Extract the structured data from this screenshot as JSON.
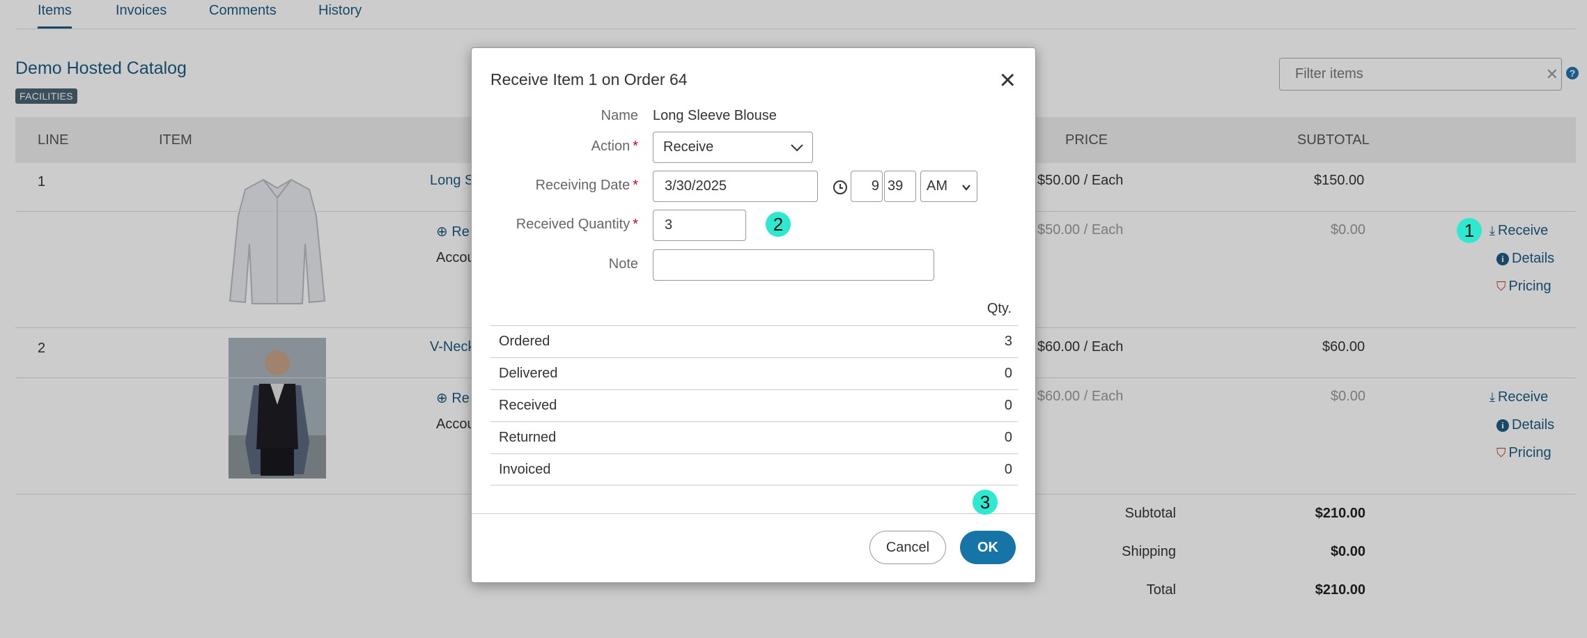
{
  "tabs": [
    "Items",
    "Invoices",
    "Comments",
    "History"
  ],
  "catalog": {
    "title": "Demo Hosted Catalog",
    "badge": "FACILITIES"
  },
  "filter": {
    "placeholder": "Filter items",
    "clear": "✕",
    "help": "?"
  },
  "table": {
    "headers": {
      "line": "LINE",
      "item": "ITEM",
      "price": "PRICE",
      "subtotal": "SUBTOTAL"
    },
    "rows": [
      {
        "line": "1",
        "name": "Long S",
        "link_prefix": "Re",
        "account": "Accou",
        "price": "$50.00 / Each",
        "subtotal": "$150.00",
        "sub_price": "$50.00 / Each",
        "sub_subtotal": "$0.00"
      },
      {
        "line": "2",
        "name": "V-Neck",
        "link_prefix": "Re",
        "account": "Accou",
        "price": "$60.00 / Each",
        "subtotal": "$60.00",
        "sub_price": "$60.00 / Each",
        "sub_subtotal": "$0.00"
      }
    ],
    "actions": {
      "receive": "Receive",
      "details": "Details",
      "pricing": "Pricing"
    }
  },
  "summary": {
    "subtotal_label": "Subtotal",
    "subtotal": "$210.00",
    "shipping_label": "Shipping",
    "shipping": "$0.00",
    "total_label": "Total",
    "total": "$210.00"
  },
  "modal": {
    "title": "Receive Item 1 on Order 64",
    "close": "×",
    "name_label": "Name",
    "name_value": "Long Sleeve Blouse",
    "action_label": "Action",
    "action_value": "Receive",
    "date_label": "Receiving Date",
    "date_value": "3/30/2025",
    "hour": "9",
    "minute": "39",
    "ampm": "AM",
    "qty_label": "Received Quantity",
    "qty_value": "3",
    "note_label": "Note",
    "note_value": "",
    "qty_header": "Qty.",
    "qty_rows": [
      {
        "label": "Ordered",
        "value": "3"
      },
      {
        "label": "Delivered",
        "value": "0"
      },
      {
        "label": "Received",
        "value": "0"
      },
      {
        "label": "Returned",
        "value": "0"
      },
      {
        "label": "Invoiced",
        "value": "0"
      }
    ],
    "cancel": "Cancel",
    "ok": "OK"
  },
  "markers": [
    "1",
    "2",
    "3"
  ]
}
